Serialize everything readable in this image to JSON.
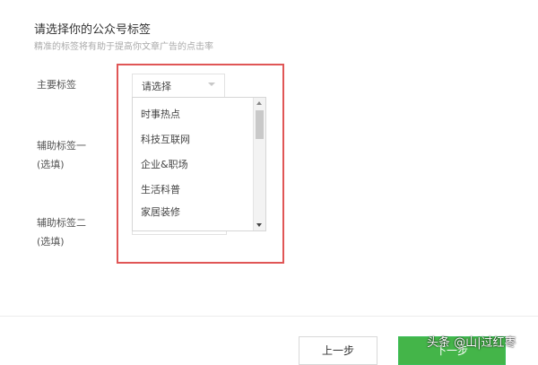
{
  "header": {
    "title": "请选择你的公众号标签",
    "subtitle": "精准的标签将有助于提高你文章广告的点击率"
  },
  "fields": {
    "primary_label": "主要标签",
    "secondary1_label_line1": "辅助标签一",
    "secondary1_label_line2": "(选填)",
    "secondary2_label_line1": "辅助标签二",
    "secondary2_label_line2": "(选填)"
  },
  "select": {
    "value": "请选择",
    "icon": "chevron-down-icon"
  },
  "dropdown": {
    "options": [
      "时事热点",
      "科技互联网",
      "企业&职场",
      "生活科普",
      "家居装修"
    ],
    "scroll_position": 0.0
  },
  "footer": {
    "prev_label": "上一步",
    "next_label": "下一步"
  },
  "watermark": {
    "text": "头条 @山|过红枣"
  },
  "colors": {
    "highlight": "#e05656",
    "primary_button": "#44b549"
  }
}
